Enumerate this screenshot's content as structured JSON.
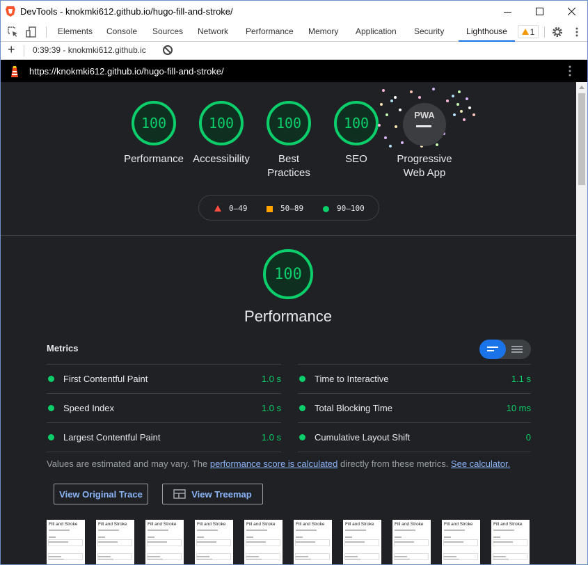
{
  "window": {
    "title": "DevTools - knokmki612.github.io/hugo-fill-and-stroke/"
  },
  "devtools": {
    "tabs": [
      "Elements",
      "Console",
      "Sources",
      "Network",
      "Performance",
      "Memory",
      "Application",
      "Security",
      "Lighthouse"
    ],
    "active_tab": "Lighthouse",
    "warnings_count": "1"
  },
  "toolbar": {
    "add_label": "+",
    "report_select": "0:39:39 - knokmki612.github.ic"
  },
  "page": {
    "url": "https://knokmki612.github.io/hugo-fill-and-stroke/"
  },
  "categories": [
    {
      "score": "100",
      "label": "Performance"
    },
    {
      "score": "100",
      "label": "Accessibility"
    },
    {
      "score": "100",
      "label": "Best Practices"
    },
    {
      "score": "100",
      "label": "SEO"
    }
  ],
  "pwa": {
    "badge": "PWA",
    "label": "Progressive Web App"
  },
  "legend": {
    "fail": "0–49",
    "average": "50–89",
    "pass": "90–100"
  },
  "performance": {
    "score": "100",
    "title": "Performance"
  },
  "metrics": {
    "header": "Metrics",
    "items": [
      {
        "label": "First Contentful Paint",
        "value": "1.0 s"
      },
      {
        "label": "Time to Interactive",
        "value": "1.1 s"
      },
      {
        "label": "Speed Index",
        "value": "1.0 s"
      },
      {
        "label": "Total Blocking Time",
        "value": "10 ms"
      },
      {
        "label": "Largest Contentful Paint",
        "value": "1.0 s"
      },
      {
        "label": "Cumulative Layout Shift",
        "value": "0"
      }
    ]
  },
  "note": {
    "prefix": "Values are estimated and may vary. The ",
    "link1": "performance score is calculated",
    "middle": " directly from these metrics. ",
    "link2": "See calculator."
  },
  "buttons": {
    "trace": "View Original Trace",
    "treemap": "View Treemap"
  },
  "filmstrip": {
    "frame_title": "Fill and Stroke",
    "frame_count": 10
  },
  "colors": {
    "pass": "#0cce6b",
    "average": "#ffa400",
    "fail": "#ff4e42",
    "accent": "#1a73e8",
    "background": "#202124"
  }
}
